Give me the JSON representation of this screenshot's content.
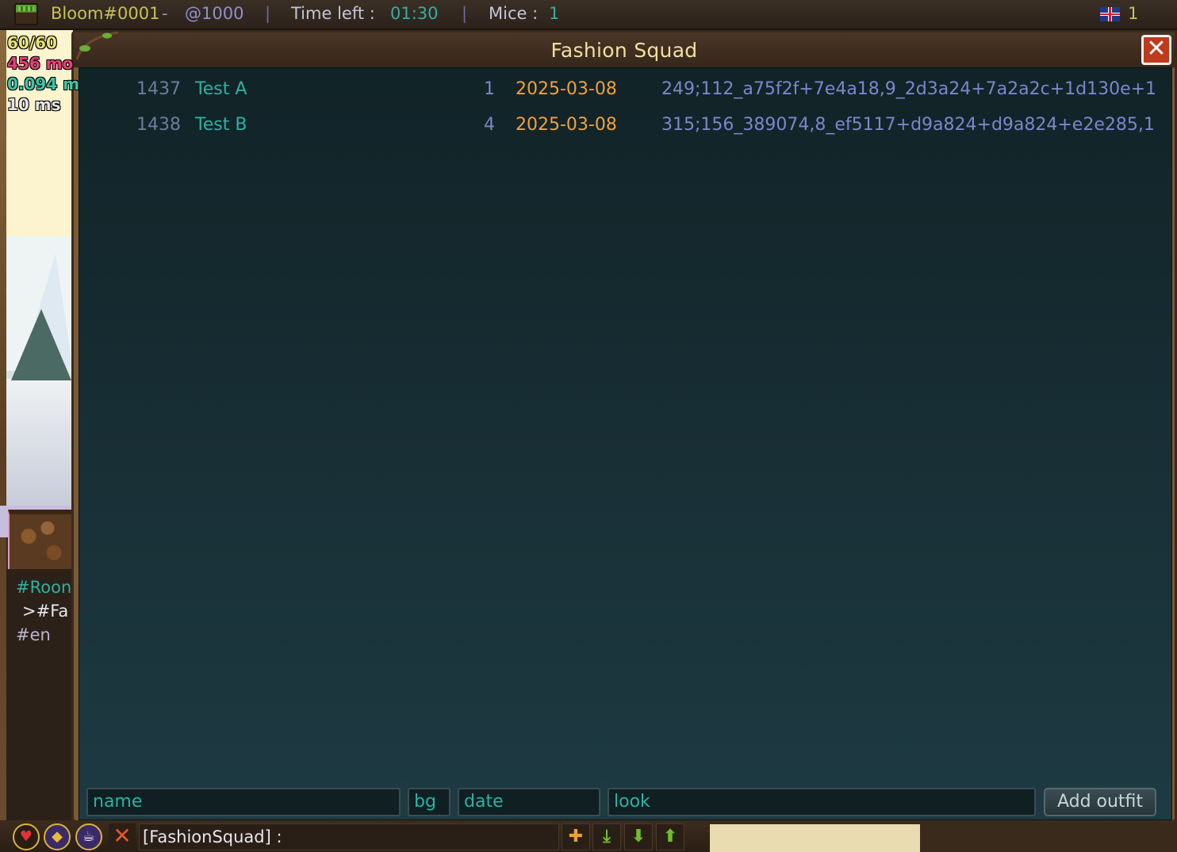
{
  "topbar": {
    "room_name": "Bloom#0001",
    "dash": " - ",
    "code": "@1000",
    "sep": "|",
    "time_label": "Time left : ",
    "time_value": "01:30",
    "mice_label": "Mice : ",
    "mice_value": "1",
    "player_count": "1"
  },
  "stats": {
    "fps": "60/60",
    "memory": "456 mo",
    "m_value": "0.094 m",
    "ping": "10 ms"
  },
  "side_chat": [
    "#Roon",
    ">#Fa",
    "#en"
  ],
  "window": {
    "title": "Fashion Squad",
    "close": "✕"
  },
  "outfits": [
    {
      "id": "1437",
      "name": "Test A",
      "bg": "1",
      "date": "2025-03-08",
      "look": "249;112_a75f2f+7e4a18,9_2d3a24+7a2a2c+1d130e+1"
    },
    {
      "id": "1438",
      "name": "Test B",
      "bg": "4",
      "date": "2025-03-08",
      "look": "315;156_389074,8_ef5117+d9a824+d9a824+e2e285,1"
    }
  ],
  "form": {
    "name_placeholder": "name",
    "bg_placeholder": "bg",
    "date_placeholder": "date",
    "look_placeholder": "look",
    "add_button": "Add outfit"
  },
  "bottombar": {
    "chat_prefix": "[FashionSquad] :",
    "icons": [
      "heart-icon",
      "shield-icon",
      "tea-icon",
      "close-icon",
      "plus-icon",
      "download-icon",
      "arrow-down-icon",
      "arrow-up-icon"
    ]
  }
}
